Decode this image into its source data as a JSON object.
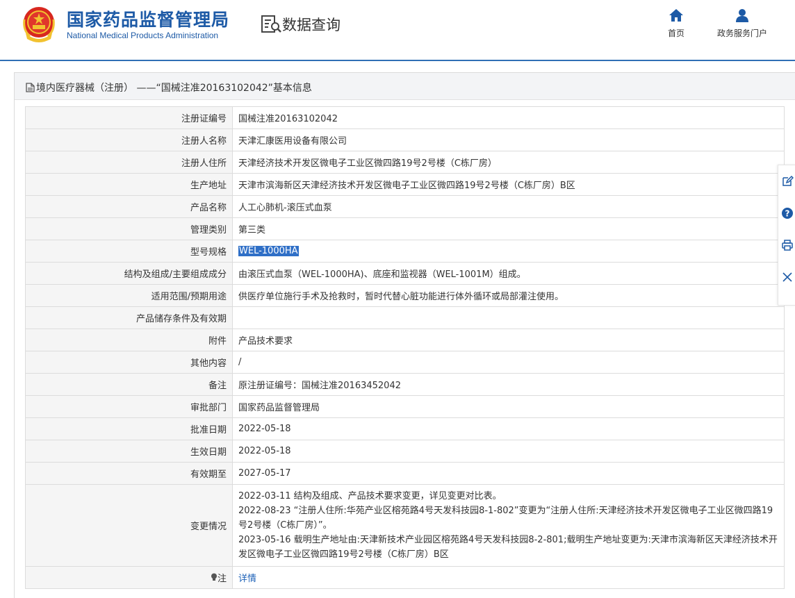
{
  "header": {
    "org_name_cn": "国家药品监督管理局",
    "org_name_en": "National Medical Products Administration",
    "page_name": "数据查询",
    "nav": [
      {
        "label": "首页",
        "icon": "home-icon"
      },
      {
        "label": "政务服务门户",
        "icon": "user-icon"
      }
    ]
  },
  "panel": {
    "title": "境内医疗器械（注册） ——“国械注准20163102042”基本信息"
  },
  "rows": [
    {
      "label": "注册证编号",
      "value": "国械注准20163102042"
    },
    {
      "label": "注册人名称",
      "value": "天津汇康医用设备有限公司"
    },
    {
      "label": "注册人住所",
      "value": "天津经济技术开发区微电子工业区微四路19号2号楼（C栋厂房）"
    },
    {
      "label": "生产地址",
      "value": "天津市滨海新区天津经济技术开发区微电子工业区微四路19号2号楼（C栋厂房）B区"
    },
    {
      "label": "产品名称",
      "value": "人工心肺机-滚压式血泵"
    },
    {
      "label": "管理类别",
      "value": "第三类"
    },
    {
      "label": "型号规格",
      "value": "WEL-1000HA"
    },
    {
      "label": "结构及组成/主要组成成分",
      "value": "由滚压式血泵（WEL-1000HA)、底座和监视器（WEL-1001M）组成。"
    },
    {
      "label": "适用范围/预期用途",
      "value": "供医疗单位施行手术及抢救时，暂时代替心脏功能进行体外循环或局部灌注使用。"
    },
    {
      "label": "产品储存条件及有效期",
      "value": ""
    },
    {
      "label": "附件",
      "value": "产品技术要求"
    },
    {
      "label": "其他内容",
      "value": "/"
    },
    {
      "label": "备注",
      "value": "原注册证编号：国械注准20163452042"
    },
    {
      "label": "审批部门",
      "value": "国家药品监督管理局"
    },
    {
      "label": "批准日期",
      "value": "2022-05-18"
    },
    {
      "label": "生效日期",
      "value": "2022-05-18"
    },
    {
      "label": "有效期至",
      "value": "2027-05-17"
    }
  ],
  "change": {
    "label": "变更情况",
    "lines": [
      "2022-03-11 结构及组成、产品技术要求变更，详见变更对比表。",
      "2022-08-23 “注册人住所:华苑产业区榕苑路4号天发科技园8-1-802”变更为“注册人住所:天津经济技术开发区微电子工业区微四路19号2号楼（C栋厂房）”。",
      "2023-05-16 载明生产地址由:天津新技术产业园区榕苑路4号天发科技园8-2-801;载明生产地址变更为:天津市滨海新区天津经济技术开发区微电子工业区微四路19号2号楼（C栋厂房）B区"
    ]
  },
  "note": {
    "label": "注",
    "link": "详情"
  },
  "floating_tools": [
    "edit-icon",
    "help-icon",
    "print-icon",
    "close-icon"
  ],
  "colors": {
    "brand_blue": "#1d5aa6",
    "selection_highlight": "#2f6fc7",
    "link_blue": "#1e62b8"
  }
}
